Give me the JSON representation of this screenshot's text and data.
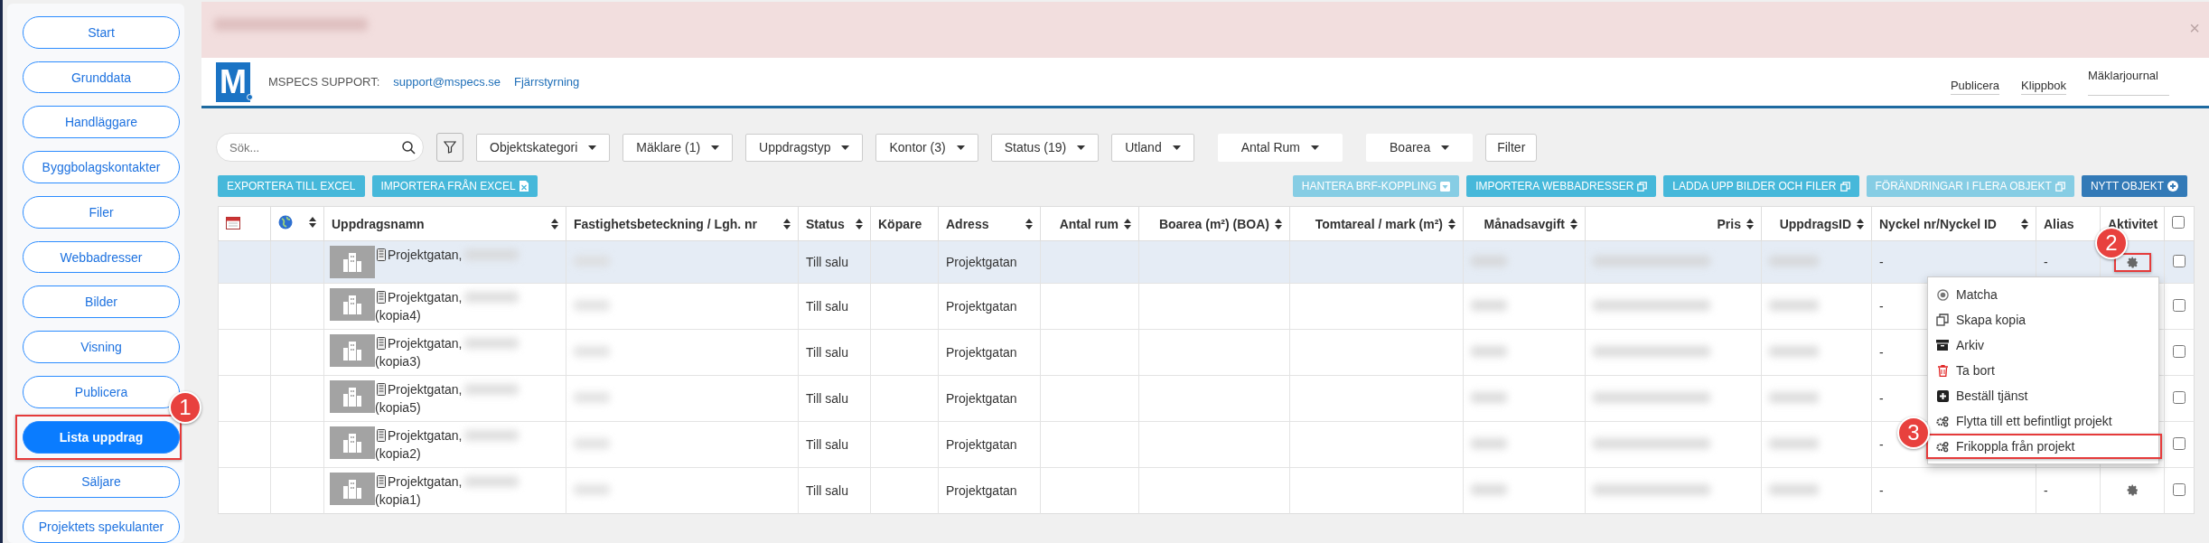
{
  "sidebar": {
    "items": [
      {
        "label": "Start",
        "selected": false
      },
      {
        "label": "Grunddata",
        "selected": false
      },
      {
        "label": "Handläggare",
        "selected": false
      },
      {
        "label": "Byggbolagskontakter",
        "selected": false
      },
      {
        "label": "Filer",
        "selected": false
      },
      {
        "label": "Webbadresser",
        "selected": false
      },
      {
        "label": "Bilder",
        "selected": false
      },
      {
        "label": "Visning",
        "selected": false
      },
      {
        "label": "Publicera",
        "selected": false
      },
      {
        "label": "Lista uppdrag",
        "selected": true,
        "callout": "1"
      },
      {
        "label": "Säljare",
        "selected": false
      },
      {
        "label": "Projektets spekulanter",
        "selected": false
      }
    ]
  },
  "alert": {
    "close": "×"
  },
  "header": {
    "logo": "M",
    "support_label": "MSPECS SUPPORT:",
    "support_email": "support@mspecs.se",
    "remote_link": "Fjärrstyrning",
    "nav": [
      {
        "label": "Publicera",
        "selected": false
      },
      {
        "label": "Klippbok",
        "selected": false
      },
      {
        "label": "Mäklarjournal",
        "selected": true
      }
    ]
  },
  "filters": {
    "search_placeholder": "Sök...",
    "dropdowns": [
      {
        "label": "Objektskategori",
        "bordered": true
      },
      {
        "label": "Mäklare (1)",
        "bordered": true
      },
      {
        "label": "Uppdragstyp",
        "bordered": true
      },
      {
        "label": "Kontor (3)",
        "bordered": true
      },
      {
        "label": "Status (19)",
        "bordered": true
      },
      {
        "label": "Utland",
        "bordered": true
      },
      {
        "label": "Antal Rum",
        "bordered": false
      },
      {
        "label": "Boarea",
        "bordered": false
      }
    ],
    "filter_button": "Filter"
  },
  "actions": {
    "left": [
      {
        "label": "EXPORTERA TILL EXCEL",
        "kind": "plain",
        "disabled": false,
        "primary": false
      },
      {
        "label": "IMPORTERA FRÅN EXCEL",
        "kind": "excel",
        "disabled": false,
        "primary": false
      }
    ],
    "right": [
      {
        "label": "HANTERA BRF-KOPPLING",
        "kind": "toggle",
        "disabled": true,
        "primary": false
      },
      {
        "label": "IMPORTERA WEBBADRESSER",
        "kind": "copy",
        "disabled": false,
        "primary": false
      },
      {
        "label": "LADDA UPP BILDER OCH FILER",
        "kind": "copy",
        "disabled": false,
        "primary": false
      },
      {
        "label": "FÖRÄNDRINGAR I FLERA OBJEKT",
        "kind": "copy",
        "disabled": true,
        "primary": false
      },
      {
        "label": "NYTT OBJEKT",
        "kind": "add",
        "disabled": false,
        "primary": true
      }
    ]
  },
  "table": {
    "columns": [
      {
        "kind": "calendar",
        "sortable": false
      },
      {
        "kind": "globe",
        "sortable": true
      },
      {
        "kind": "text",
        "label": "Uppdragsnamn",
        "sortable": true
      },
      {
        "kind": "text",
        "label": "Fastighetsbeteckning / Lgh. nr",
        "sortable": true
      },
      {
        "kind": "text",
        "label": "Status",
        "sortable": true
      },
      {
        "kind": "text",
        "label": "Köpare",
        "sortable": false
      },
      {
        "kind": "text",
        "label": "Adress",
        "sortable": true
      },
      {
        "kind": "text",
        "label": "Antal rum",
        "sortable": true
      },
      {
        "kind": "text",
        "label": "Boarea (m²) (BOA)",
        "sortable": true
      },
      {
        "kind": "text",
        "label": "Tomtareal / mark (m²)",
        "sortable": true
      },
      {
        "kind": "text",
        "label": "Månadsavgift",
        "sortable": true
      },
      {
        "kind": "text",
        "label": "Pris",
        "sortable": true
      },
      {
        "kind": "text",
        "label": "UppdragsID",
        "sortable": true
      },
      {
        "kind": "text",
        "label": "Nyckel nr/Nyckel ID",
        "sortable": true
      },
      {
        "kind": "text",
        "label": "Alias",
        "sortable": false
      },
      {
        "kind": "text",
        "label": "Aktivitet",
        "sortable": false
      },
      {
        "kind": "checkbox",
        "checked": false
      }
    ],
    "rows": [
      {
        "selected": true,
        "name": "Projektgatan,",
        "status": "Till salu",
        "address": "Projektgatan",
        "key": "-",
        "alias": "-",
        "activity": true,
        "activity_callout": "2",
        "checked": false
      },
      {
        "selected": false,
        "name": "Projektgatan,",
        "name_suffix": "(kopia4)",
        "status": "Till salu",
        "address": "Projektgatan",
        "key": "-",
        "activity": false,
        "checked": false
      },
      {
        "selected": false,
        "name": "Projektgatan,",
        "name_suffix": "(kopia3)",
        "status": "Till salu",
        "address": "Projektgatan",
        "key": "-",
        "activity": false,
        "checked": false
      },
      {
        "selected": false,
        "name": "Projektgatan,",
        "name_suffix": "(kopia5)",
        "status": "Till salu",
        "address": "Projektgatan",
        "key": "-",
        "activity": false,
        "checked": false
      },
      {
        "selected": false,
        "name": "Projektgatan,",
        "name_suffix": "(kopia2)",
        "status": "Till salu",
        "address": "Projektgatan",
        "key": "-",
        "activity": false,
        "checked": false
      },
      {
        "selected": false,
        "name": "Projektgatan,",
        "name_suffix": "(kopia1)",
        "status": "Till salu",
        "address": "Projektgatan",
        "key": "-",
        "alias": "-",
        "activity": true,
        "checked": false
      }
    ]
  },
  "menu": {
    "items": [
      {
        "kind": "match",
        "label": "Matcha",
        "highlighted": false
      },
      {
        "kind": "copy",
        "label": "Skapa kopia",
        "highlighted": false
      },
      {
        "kind": "archive",
        "label": "Arkiv",
        "highlighted": false
      },
      {
        "kind": "delete",
        "label": "Ta bort",
        "highlighted": false
      },
      {
        "kind": "order",
        "label": "Beställ tjänst",
        "highlighted": false
      },
      {
        "kind": "move",
        "label": "Flytta till ett befintligt projekt",
        "highlighted": false
      },
      {
        "kind": "unlink",
        "label": "Frikoppla från projekt",
        "highlighted": true,
        "callout": "3"
      }
    ]
  }
}
